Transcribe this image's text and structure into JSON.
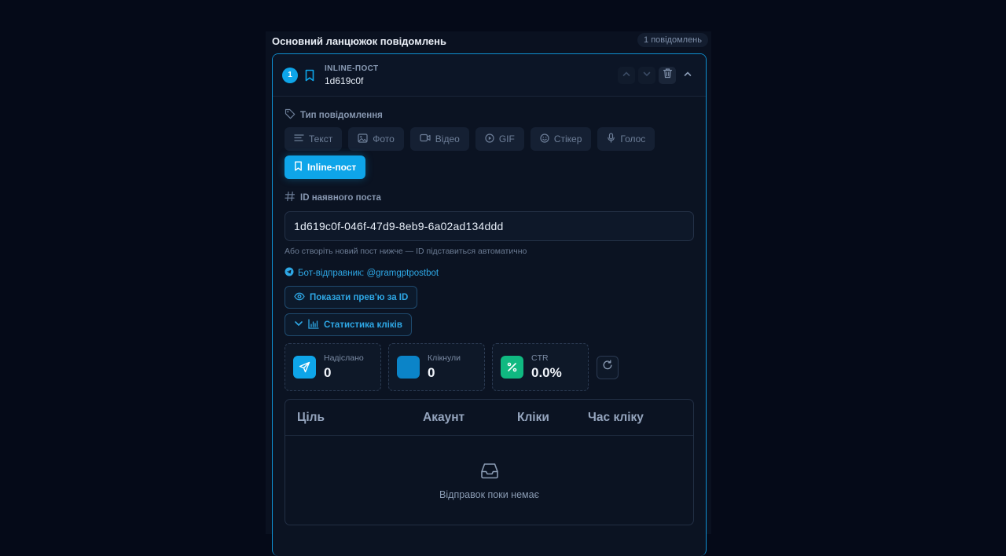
{
  "section": {
    "title": "Основний ланцюжок повідомлень",
    "count_badge": "1 повідомлень"
  },
  "message": {
    "step_number": "1",
    "type_label": "INLINE-ПОСТ",
    "short_id": "1d619c0f"
  },
  "type_selector": {
    "label": "Тип повідомлення",
    "options": [
      {
        "label": "Текст",
        "icon": "text-lines-icon"
      },
      {
        "label": "Фото",
        "icon": "image-icon"
      },
      {
        "label": "Відео",
        "icon": "video-icon"
      },
      {
        "label": "GIF",
        "icon": "play-circle-icon"
      },
      {
        "label": "Стікер",
        "icon": "smile-icon"
      },
      {
        "label": "Голос",
        "icon": "microphone-icon"
      },
      {
        "label": "Inline-пост",
        "icon": "bookmark-icon",
        "selected": true
      }
    ]
  },
  "post_id": {
    "label": "ID наявного поста",
    "value": "1d619c0f-046f-47d9-8eb9-6a02ad134ddd",
    "hint": "Або створіть новий пост нижче — ID підставиться автоматично"
  },
  "bot": {
    "text": "Бот-відправник: @gramgptpostbot"
  },
  "buttons": {
    "preview": "Показати прев'ю за ID",
    "stats": "Статистика кліків"
  },
  "stats": [
    {
      "label": "Надіслано",
      "value": "0",
      "color": "#0ea5e9",
      "icon": "send-icon"
    },
    {
      "label": "Клікнули",
      "value": "0",
      "color": "#0b84c8",
      "icon": "cursor-icon"
    },
    {
      "label": "CTR",
      "value": "0.0%",
      "color": "#10b981",
      "icon": "percent-icon"
    }
  ],
  "table": {
    "columns": [
      "Ціль",
      "Акаунт",
      "Кліки",
      "Час кліку"
    ],
    "empty_text": "Відправок поки немає"
  },
  "colors": {
    "accent": "#0ea5e9",
    "background": "#050a18",
    "card": "#0b1322",
    "success": "#10b981"
  }
}
